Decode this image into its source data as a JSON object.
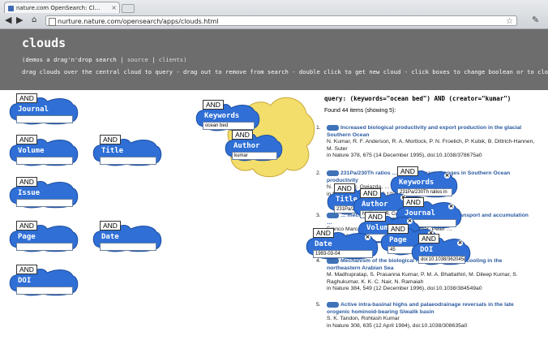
{
  "browser": {
    "tab_title": "nature.com OpenSearch: Cl…",
    "url": "nurture.nature.com/opensearch/apps/clouds.html"
  },
  "header": {
    "title": "clouds",
    "sub_prefix": "(demos a drag'n'drop search |",
    "source_link": "source",
    "sep": "|",
    "clients_link": "clients)",
    "instructions": "drag clouds over the central cloud to query - drag out to remove from search - double click to get new cloud - click boxes to change boolean or to close"
  },
  "palette": [
    {
      "op": "AND",
      "label": "Journal",
      "value": ""
    },
    {
      "op": "AND",
      "label": "Volume",
      "value": ""
    },
    {
      "op": "AND",
      "label": "Title",
      "value": ""
    },
    {
      "op": "AND",
      "label": "Issue",
      "value": ""
    },
    {
      "op": "AND",
      "label": "Page",
      "value": ""
    },
    {
      "op": "AND",
      "label": "Date",
      "value": ""
    },
    {
      "op": "AND",
      "label": "DOI",
      "value": ""
    }
  ],
  "query_clouds": [
    {
      "op": "AND",
      "label": "Keywords",
      "value": "ocean bed"
    },
    {
      "op": "AND",
      "label": "Author",
      "value": "kumar"
    }
  ],
  "dragged": [
    {
      "op": "AND",
      "label": "Keywords",
      "value": "231Pa/230Th ratios in"
    },
    {
      "op": "AND",
      "label": "Title",
      "value": "231Pa/2"
    },
    {
      "op": "AND",
      "label": "Author",
      "value": "N. Kumar, R. Cu"
    },
    {
      "op": "AND",
      "label": "Journal",
      "value": ""
    },
    {
      "op": "AND",
      "label": "Volume",
      "value": ""
    },
    {
      "op": "AND",
      "label": "Page",
      "value": "45"
    },
    {
      "op": "AND",
      "label": "DOI",
      "value": "doi:10.1038/362045a0"
    },
    {
      "op": "AND",
      "label": "Date",
      "value": "1993-03-04"
    }
  ],
  "results": {
    "query": "query: (keywords=\"ocean bed\") AND (creator=\"kumar\")",
    "found": "Found 44 items (showing 5):",
    "items": [
      {
        "num": "1.",
        "title": "Increased biological productivity and export production in the glacial Southern Ocean",
        "authors": "N. Kumar, R. F. Anderson, R. A. Mortlock, P. N. Froelich, P. Kubik, B. Dittrich-Hannen, M. Suter",
        "cite": "in Nature 378, 675 (14 December 1995), doi:10.1038/378675a0"
      },
      {
        "num": "2.",
        "title": "231Pa/230Th ratios … proxy for past changes in Southern Ocean productivity",
        "authors": "N. Kumar, R. Gwiazda, … Froelich",
        "cite": "in Nature 362, … doi:10.1038/362045a0"
      },
      {
        "num": "3.",
        "title": "… mechanism of the biological … sediment transport and accumulation …",
        "authors": "Franco Marcantonio, … Naik, Niraj Kumar, Peter …",
        "cite": "… doi:10.1038/383705a0"
      },
      {
        "num": "4.",
        "title": "Mechanism of the biological response to winter cooling in the northeastern Arabian Sea",
        "authors": "M. Madhupratap, S. Prasanna Kumar, P. M. A. Bhattathiri, M. Dileep Kumar, S. Raghukumar, K. K. C. Nair, N. Ramaiah",
        "cite": "in Nature 384, 549 (12 December 1996), doi:10.1038/384549a0"
      },
      {
        "num": "5.",
        "title": "Active intra-basinal highs and palaeodrainage reversals in the late orogenic hominoid-bearing Siwalik basin",
        "authors": "S. K. Tandon, Rohtash Kumar",
        "cite": "in Nature 308, 635 (12 April 1984), doi:10.1038/308635a0"
      }
    ]
  },
  "colors": {
    "cloud": "#2f6fd6",
    "center_cloud": "#f3de6c",
    "header": "#6d6d6d",
    "link": "#2b5aa0"
  }
}
